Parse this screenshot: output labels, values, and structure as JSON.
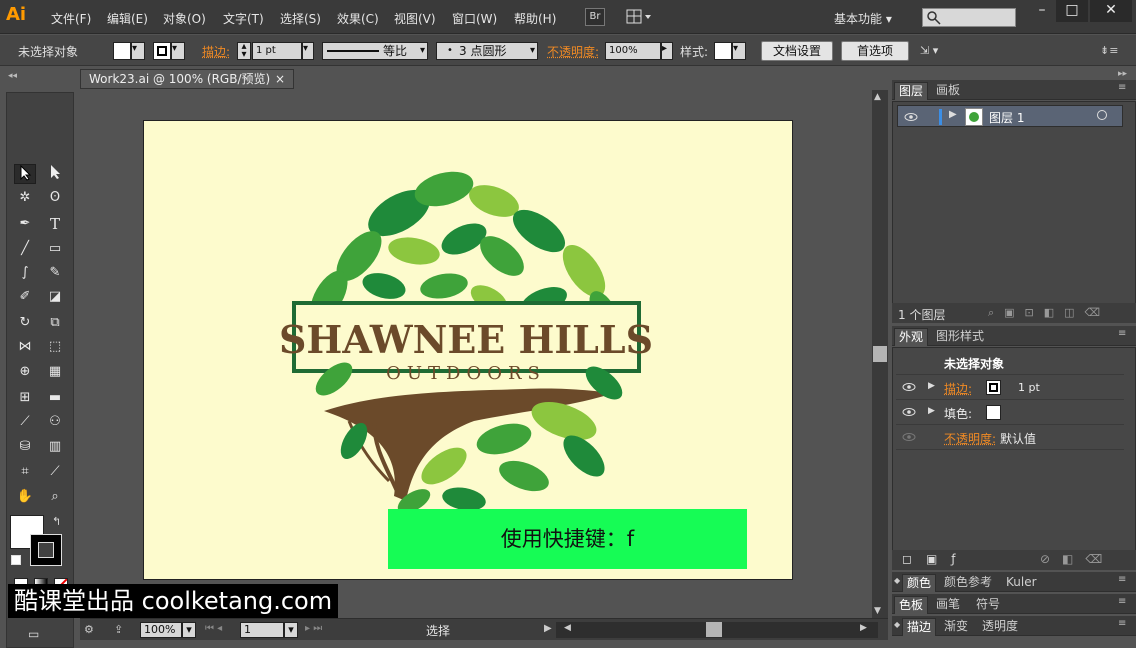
{
  "app": {
    "logo": "Ai",
    "menu": [
      "文件(F)",
      "编辑(E)",
      "对象(O)",
      "文字(T)",
      "选择(S)",
      "效果(C)",
      "视图(V)",
      "窗口(W)",
      "帮助(H)"
    ],
    "bridge": "Br",
    "workspace": "基本功能",
    "window_buttons": [
      "–",
      "□",
      "✕"
    ]
  },
  "control_bar": {
    "selection_text": "未选择对象",
    "stroke_label": "描边:",
    "stroke_value": "1 pt",
    "profile": "等比",
    "brush": "3 点圆形",
    "opacity_label": "不透明度:",
    "opacity_value": "100%",
    "style_label": "样式:",
    "doc_settings": "文档设置",
    "preferences": "首选项"
  },
  "document": {
    "tab_title": "Work23.ai @ 100% (RGB/预览)",
    "tab_close": "×"
  },
  "artwork": {
    "title": "SHAWNEE HILLS",
    "subtitle": "OUTDOORS",
    "hint": "使用快捷键：f"
  },
  "status_bar": {
    "zoom": "100%",
    "page": "1",
    "tool": "选择"
  },
  "layers_panel": {
    "tabs": [
      "图层",
      "画板"
    ],
    "layer_name": "图层 1",
    "count": "1 个图层"
  },
  "appearance_panel": {
    "tabs": [
      "外观",
      "图形样式"
    ],
    "header": "未选择对象",
    "stroke_label": "描边:",
    "stroke_value": "1 pt",
    "fill_label": "填色:",
    "opacity_label": "不透明度:",
    "opacity_value": "默认值"
  },
  "color_tabs_1": [
    "颜色",
    "颜色参考",
    "Kuler"
  ],
  "color_tabs_2": [
    "色板",
    "画笔",
    "符号"
  ],
  "color_tabs_3": [
    "描边",
    "渐变",
    "透明度"
  ],
  "watermark": "酷课堂出品 coolketang.com",
  "colors": {
    "accent_orange": "#f08a24",
    "artboard": "#fdfbcd",
    "hint_green": "#16fc55",
    "logo_brown": "#6b4a2a",
    "leaf_dark": "#1f8a3a",
    "leaf_mid": "#3fa33a",
    "leaf_light": "#8cc63f"
  }
}
